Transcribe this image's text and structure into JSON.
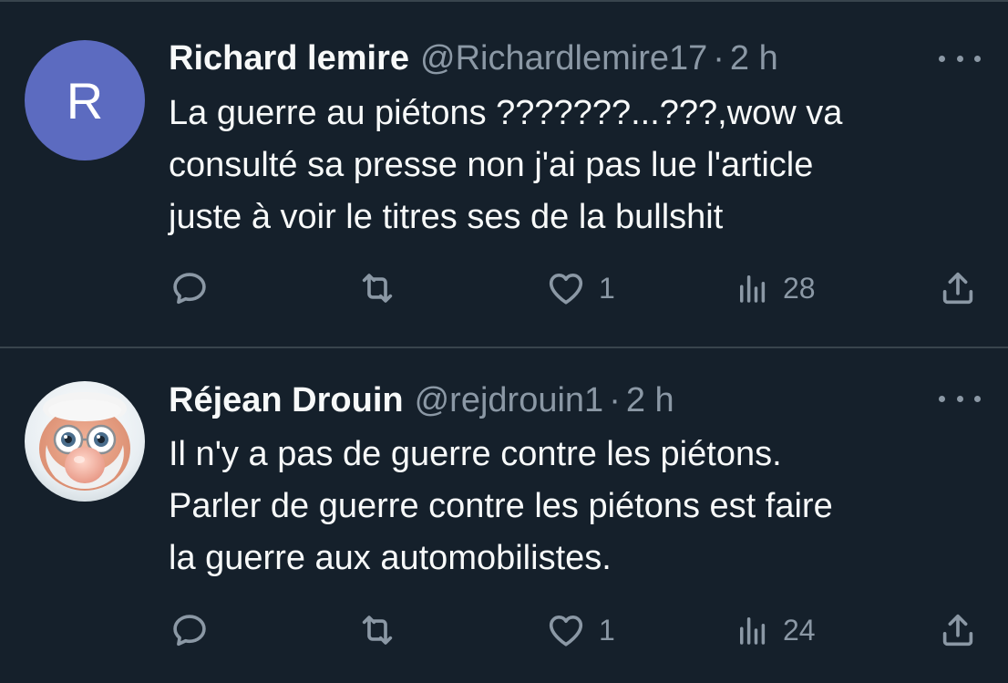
{
  "tweets": [
    {
      "avatar_letter": "R",
      "avatar_color": "#5c6bc0",
      "name": "Richard lemire",
      "handle": "@Richardlemire17",
      "separator": "·",
      "time": "2 h",
      "lines": [
        "La guerre au piétons ???????...???,wow va",
        "consulté sa presse non j'ai pas lue l'article",
        "juste à voir le titres ses de la bullshit"
      ],
      "replies": "",
      "retweets": "",
      "likes": "1",
      "views": "28",
      "icons": [
        "reply-icon",
        "retweet-icon",
        "heart-icon",
        "views-icon",
        "share-icon",
        "more-icon"
      ]
    },
    {
      "avatar_letter": "",
      "name": "Réjean Drouin",
      "handle": "@rejdrouin1",
      "separator": "·",
      "time": "2 h",
      "lines": [
        "Il n'y a pas de guerre contre les piétons.",
        "Parler de guerre contre les piétons est faire",
        "la guerre aux automobilistes."
      ],
      "replies": "",
      "retweets": "",
      "likes": "1",
      "views": "24",
      "icons": [
        "reply-icon",
        "retweet-icon",
        "heart-icon",
        "views-icon",
        "share-icon",
        "more-icon"
      ]
    }
  ],
  "colors": {
    "background": "#15202b",
    "divider": "#38444d",
    "primary_text": "#f7f9f9",
    "secondary_text": "#8b98a5"
  }
}
